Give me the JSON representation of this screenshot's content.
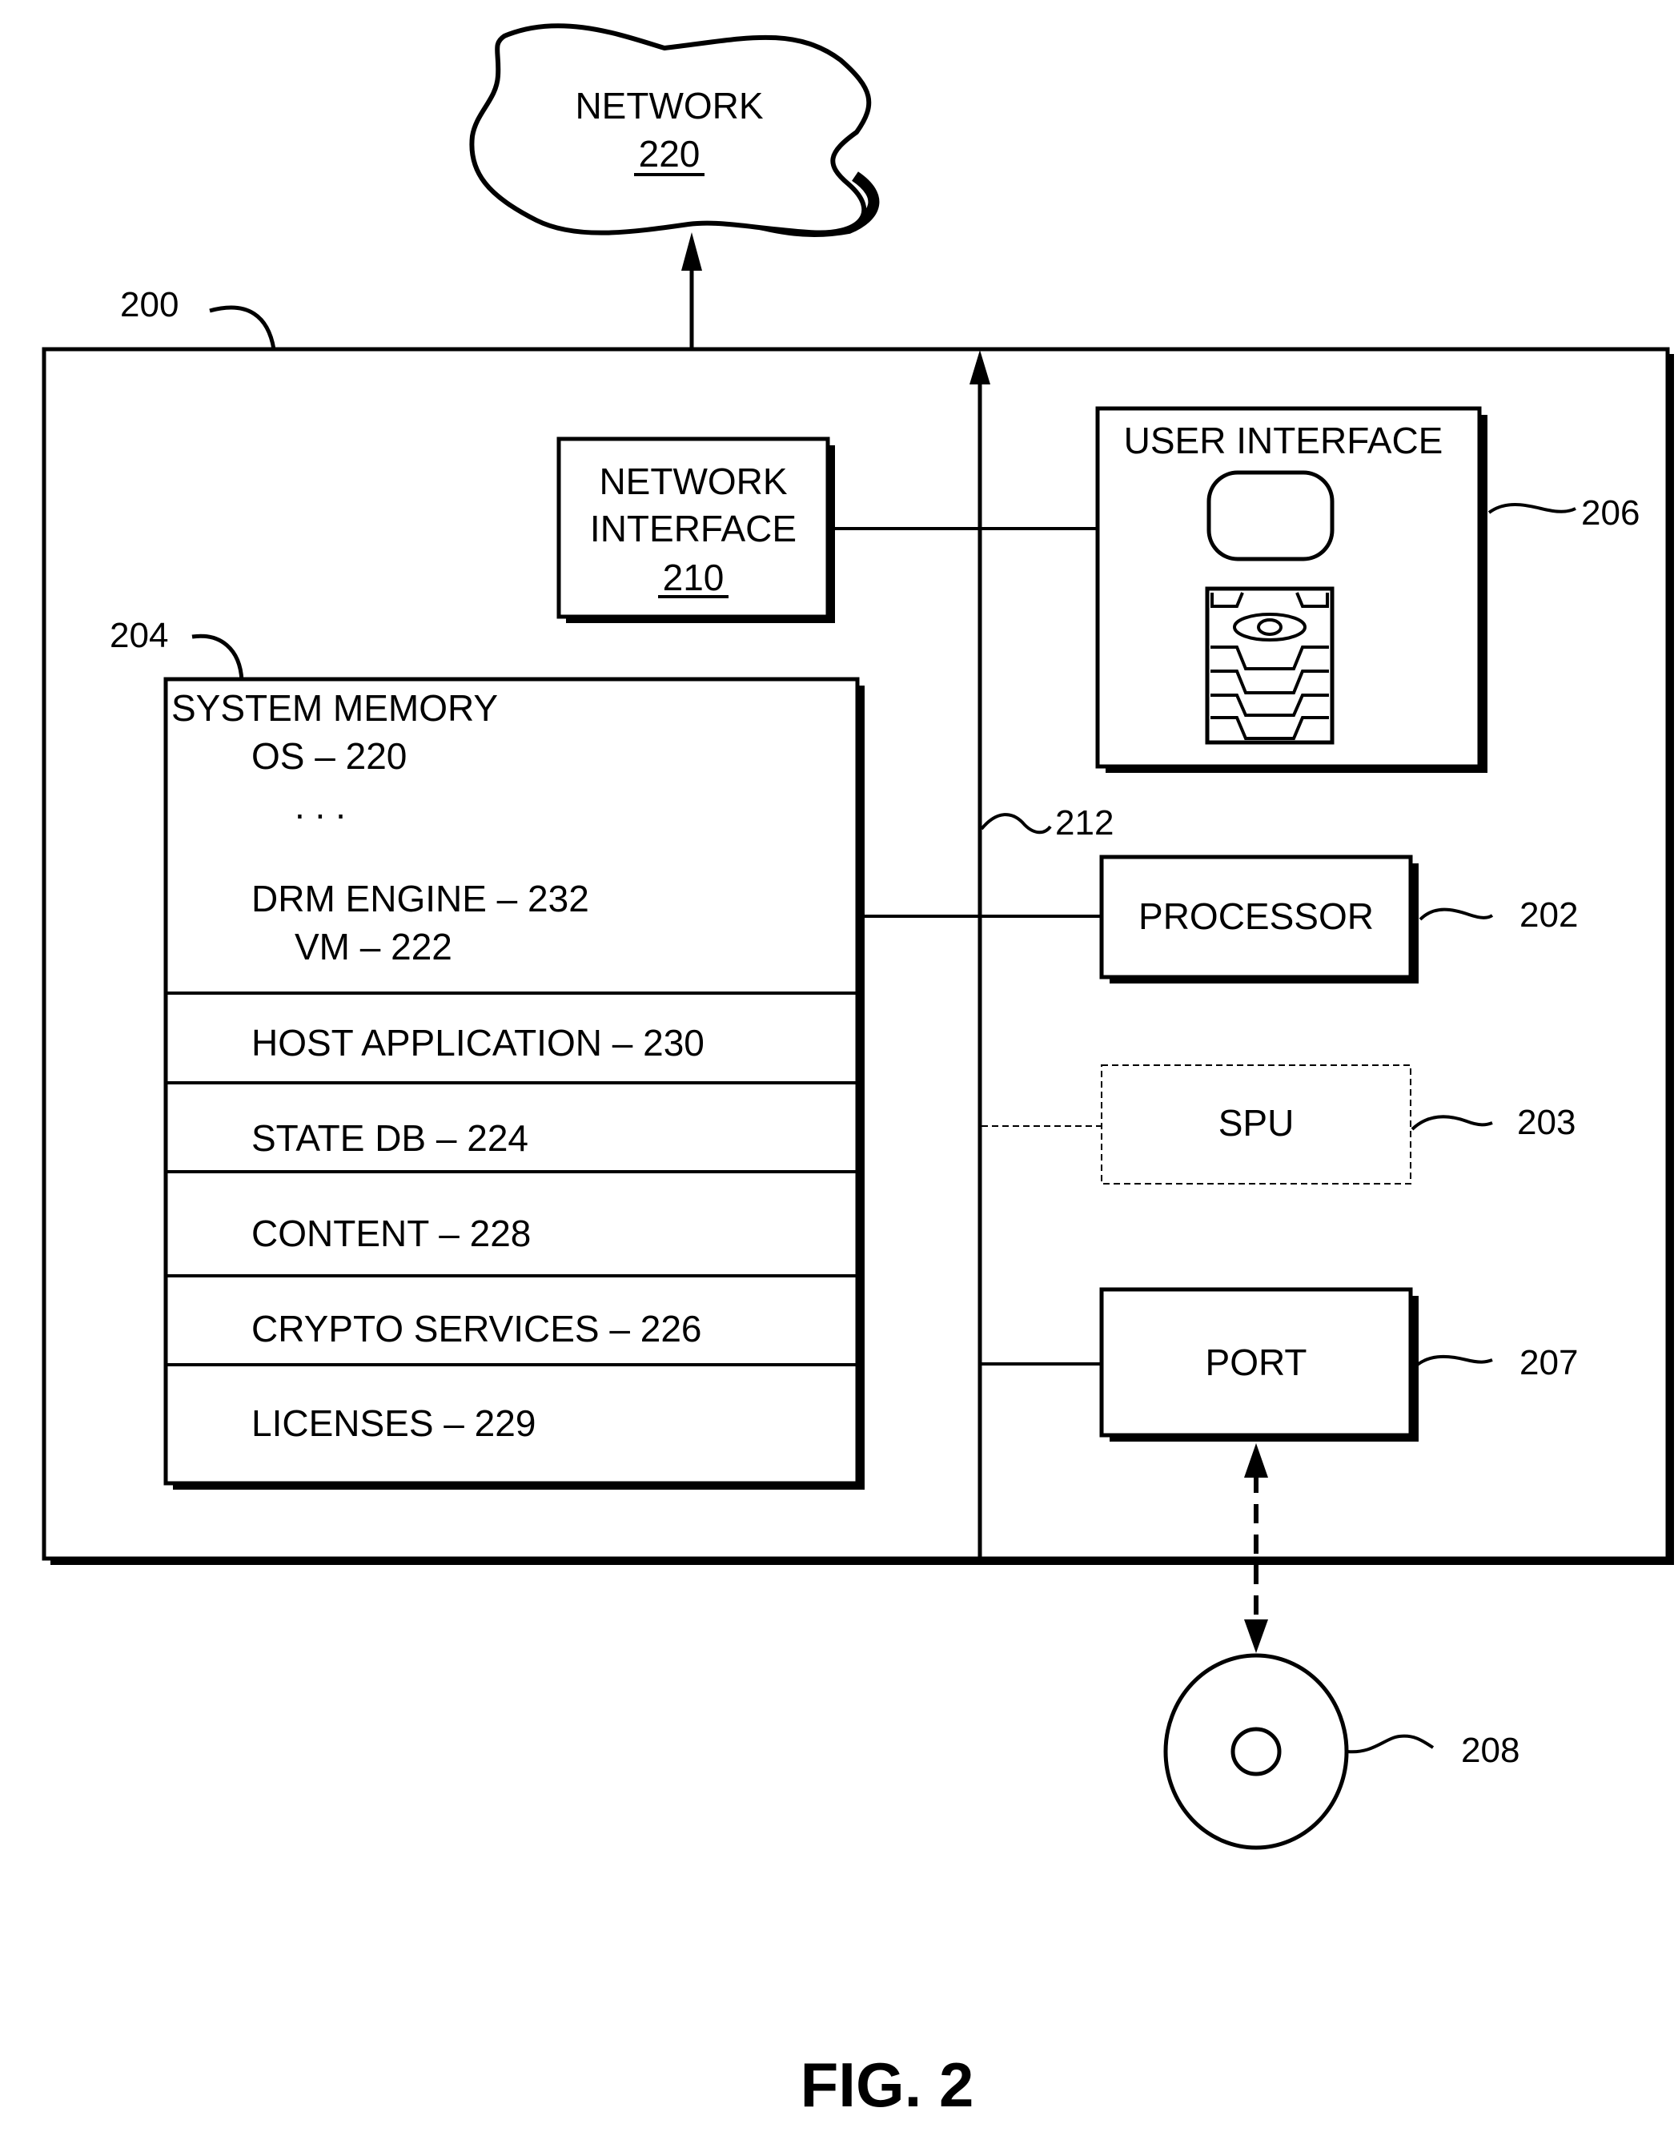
{
  "figure": {
    "caption": "FIG. 2",
    "colors": {
      "ink": "#000000",
      "paper": "#ffffff"
    }
  },
  "network": {
    "title": "NETWORK",
    "ref": "220",
    "shape": "cloud"
  },
  "device": {
    "ref": "200"
  },
  "network_interface": {
    "line1": "NETWORK",
    "line2": "INTERFACE",
    "ref": "210"
  },
  "bus": {
    "ref": "212"
  },
  "user_interface": {
    "title": "USER INTERFACE",
    "ref": "206",
    "icons": [
      "display-screen-icon",
      "keypad-icon"
    ]
  },
  "system_memory": {
    "ref": "204",
    "title": "SYSTEM MEMORY",
    "top_section": {
      "items": [
        {
          "label": "OS – 220"
        },
        {
          "label": ". . ."
        },
        {
          "label": "DRM ENGINE – 232"
        },
        {
          "label": "VM – 222"
        }
      ]
    },
    "rows": [
      {
        "label": "HOST APPLICATION – 230"
      },
      {
        "label": "STATE DB – 224"
      },
      {
        "label": "CONTENT – 228"
      },
      {
        "label": "CRYPTO SERVICES – 226"
      },
      {
        "label": "LICENSES – 229"
      }
    ]
  },
  "processor": {
    "label": "PROCESSOR",
    "ref": "202"
  },
  "spu": {
    "label": "SPU",
    "ref": "203",
    "style": "dashed (optional)"
  },
  "port": {
    "label": "PORT",
    "ref": "207"
  },
  "removable_media": {
    "ref": "208",
    "shape": "disc"
  }
}
